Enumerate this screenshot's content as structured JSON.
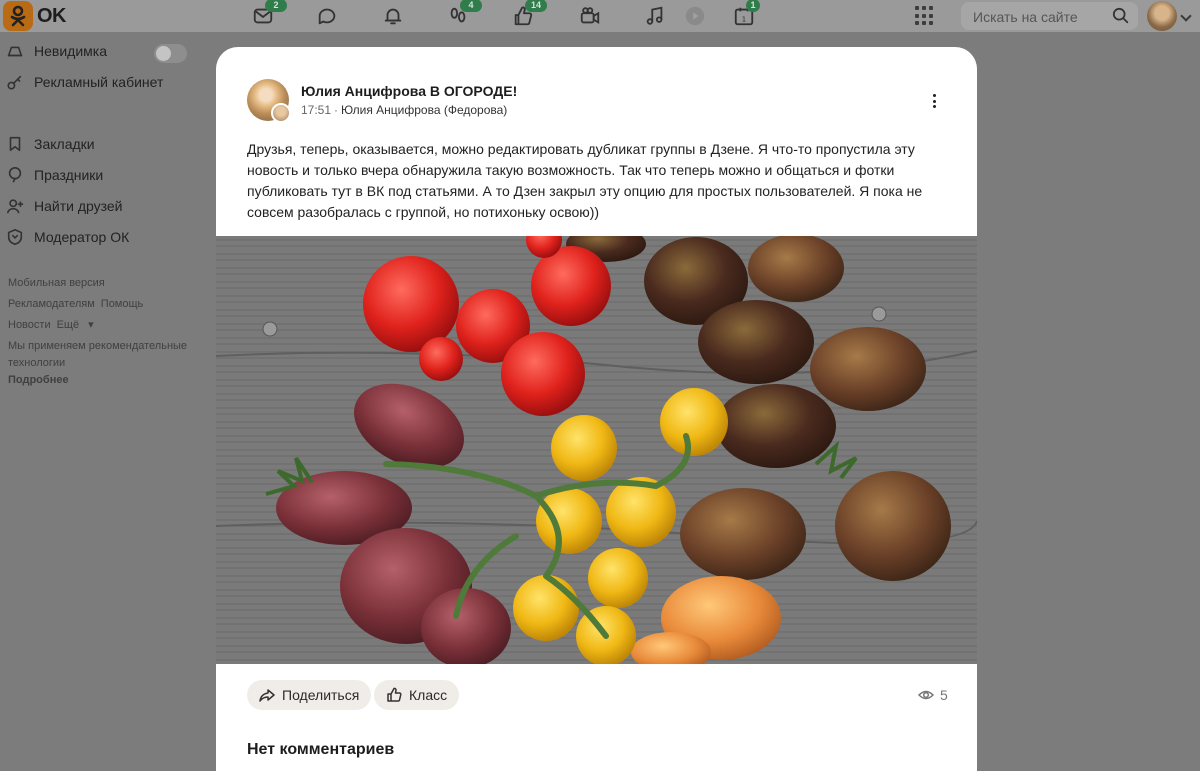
{
  "header": {
    "logo_text": "OK",
    "badges": {
      "messages": "2",
      "guests": "4",
      "likes": "14",
      "events": "1"
    },
    "search_placeholder": "Искать на сайте"
  },
  "sidebar": {
    "invisible": "Невидимка",
    "ads_cabinet": "Рекламный кабинет",
    "bookmarks": "Закладки",
    "holidays": "Праздники",
    "find_friends": "Найти друзей",
    "moderator": "Модератор ОК",
    "footer": {
      "mobile": "Мобильная версия",
      "advertisers": "Рекламодателям",
      "help": "Помощь",
      "news": "Новости",
      "more": "Ещё",
      "notice": "Мы применяем рекомендательные технологии",
      "details": "Подробнее"
    }
  },
  "post": {
    "author": "Юлия Анцифрова В ОГОРОДЕ!",
    "time": "17:51",
    "separator": "·",
    "sub_author": "Юлия Анцифрова (Федорова)",
    "text": "Друзья, теперь, оказывается, можно редактировать дубликат группы в Дзене. Я что-то пропустила эту новость и только вчера обнаружила такую возможность. Так что теперь можно и общаться и фотки публиковать тут в ВК под статьями. А то Дзен закрыл эту опцию для простых пользователей. Я пока не совсем разобралась с группой, но потихоньку освою))",
    "share_label": "Поделиться",
    "like_label": "Класс",
    "views_count": "5",
    "no_comments": "Нет комментариев"
  },
  "colors": {
    "accent": "#ee8208",
    "badge": "#2f7d4a",
    "overlay": "#7c7c7c"
  }
}
